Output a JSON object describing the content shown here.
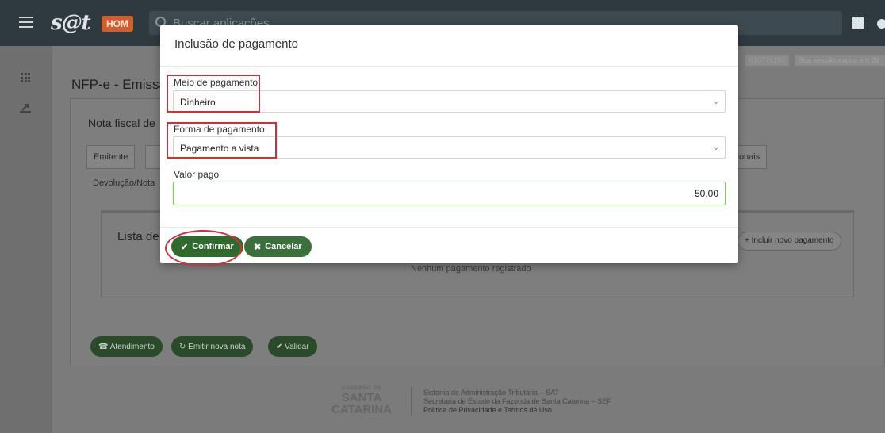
{
  "topbar": {
    "logo": "s@t",
    "env_badge": "HOM",
    "search_placeholder": "Buscar aplicações"
  },
  "info": {
    "code": "010776150",
    "session": "Sua sessão expira em 29"
  },
  "page": {
    "title": "NFP-e - Emissão",
    "card_title": "Nota fiscal de",
    "tabs": [
      "Emitente",
      "",
      "Devolução/Nota",
      "cionais"
    ],
    "list_title": "Lista de",
    "empty_text": "Nenhum pagamento registrado",
    "add_button": "Incluir novo pagamento"
  },
  "actions": {
    "atendimento": "Atendimento",
    "emitir": "Emitir nova nota",
    "validar": "Validar"
  },
  "footer": {
    "logo_top": "GOVERNO DE",
    "logo_line1": "SANTA",
    "logo_line2": "CATARINA",
    "line1": "Sistema de Administração Tributária – SAT",
    "line2": "Secretaria de Estado da Fazenda de Santa Catarina – SEF",
    "line3": "Política de Privacidade e Termos de Uso"
  },
  "modal": {
    "title": "Inclusão de pagamento",
    "meio_label": "Meio de pagamento",
    "meio_value": "Dinheiro",
    "forma_label": "Forma de pagamento",
    "forma_value": "Pagamento a vista",
    "valor_label": "Valor pago",
    "valor_value": "50,00",
    "confirm": "Confirmar",
    "cancel": "Cancelar"
  },
  "colors": {
    "accent_green": "#2e6a2e",
    "highlight_red": "#d32f3a",
    "badge_orange": "#d35e2c"
  }
}
